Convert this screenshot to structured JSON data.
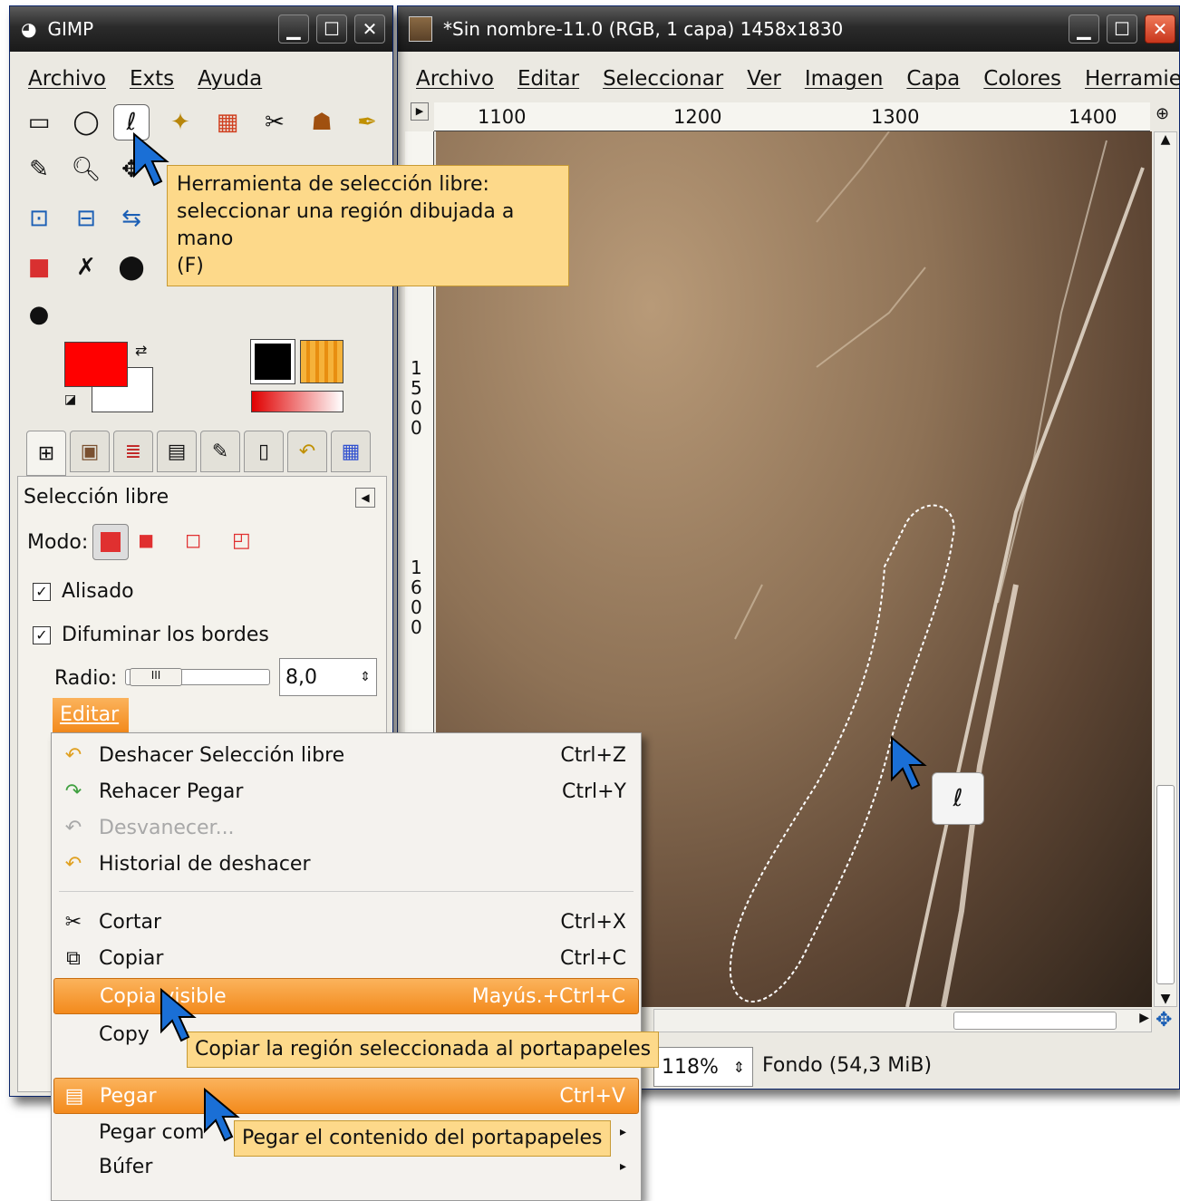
{
  "toolbox": {
    "title": "GIMP",
    "menu": [
      "Archivo",
      "Exts",
      "Ayuda"
    ],
    "tooltip_lines": [
      "Herramienta de selección libre:",
      "seleccionar una región dibujada a mano",
      "(F)"
    ],
    "panel_title": "Selección libre",
    "mode_label": "Modo:",
    "antialias_label": "Alisado",
    "feather_label": "Difuminar los bordes",
    "radius_label": "Radio:",
    "radius_value": "8,0",
    "fg_color": "#ff0000",
    "bg_color": "#ffffff"
  },
  "image_window": {
    "title": "*Sin nombre-11.0 (RGB, 1 capa) 1458x1830",
    "menu": [
      "Archivo",
      "Editar",
      "Seleccionar",
      "Ver",
      "Imagen",
      "Capa",
      "Colores",
      "Herramientas"
    ],
    "ruler_h": [
      "1100",
      "1200",
      "1300",
      "1400"
    ],
    "ruler_v": [
      "1500",
      "1600"
    ],
    "zoom": "118%",
    "status": "Fondo (54,3 MiB)"
  },
  "edit_menu": {
    "header": "Editar",
    "items": [
      {
        "icon": "undo-icon",
        "glyph": "↶",
        "label": "Deshacer Selección libre",
        "shortcut": "Ctrl+Z"
      },
      {
        "icon": "redo-icon",
        "glyph": "↷",
        "label": "Rehacer Pegar",
        "shortcut": "Ctrl+Y"
      },
      {
        "icon": "fade-icon",
        "glyph": "↶",
        "label": "Desvanecer...",
        "shortcut": ""
      },
      {
        "icon": "undo-history-icon",
        "glyph": "↶",
        "label": "Historial de deshacer",
        "shortcut": ""
      },
      {
        "icon": "cut-icon",
        "glyph": "✂",
        "label": "Cortar",
        "shortcut": "Ctrl+X"
      },
      {
        "icon": "copy-icon",
        "glyph": "⧉",
        "label": "Copiar",
        "shortcut": "Ctrl+C"
      },
      {
        "icon": "",
        "glyph": "",
        "label": "Copia visible",
        "shortcut": "Mayús.+Ctrl+C"
      },
      {
        "icon": "",
        "glyph": "",
        "label": "Copy",
        "shortcut": ""
      },
      {
        "icon": "paste-icon",
        "glyph": "▤",
        "label": "Pegar",
        "shortcut": "Ctrl+V"
      },
      {
        "icon": "",
        "glyph": "",
        "label": "Pegar com",
        "shortcut": "▸"
      },
      {
        "icon": "",
        "glyph": "",
        "label": "Búfer",
        "shortcut": "▸"
      }
    ],
    "tooltip_copy": "Copiar la región seleccionada al portapapeles",
    "tooltip_paste": "Pegar el contenido del portapapeles"
  }
}
